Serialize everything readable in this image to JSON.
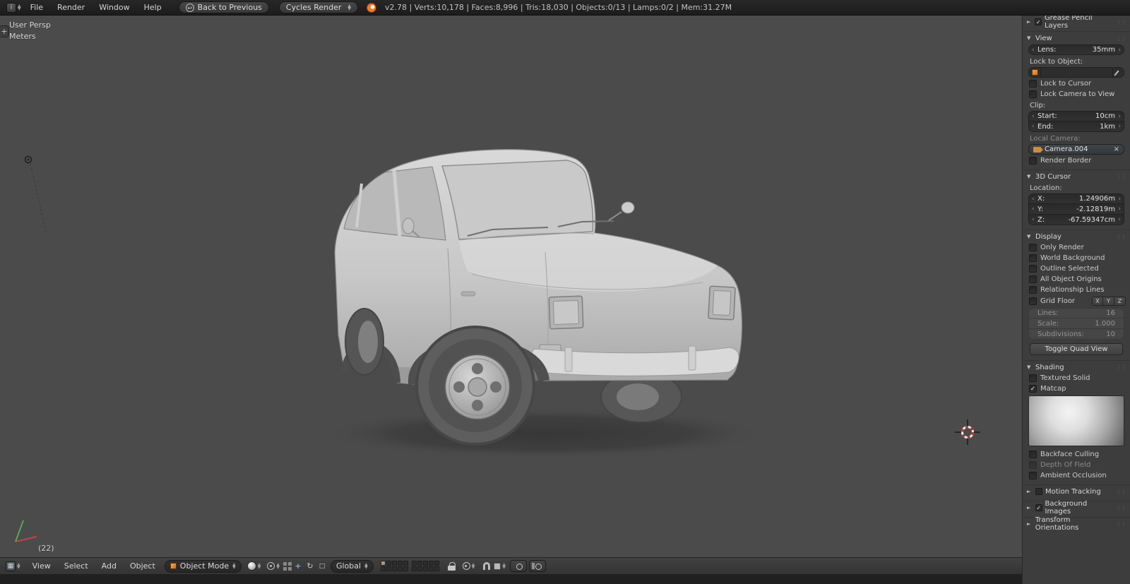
{
  "colors": {
    "accent_orange": "#e9822e",
    "viewport_bg": "#4b4b4b",
    "header_bg": "#1e1e1e",
    "panel_bg": "#3d3d3d"
  },
  "top_bar": {
    "menus": [
      "File",
      "Render",
      "Window",
      "Help"
    ],
    "back_button": "Back to Previous",
    "engine_dropdown": "Cycles Render",
    "stats": "v2.78 | Verts:10,178 | Faces:8,996 | Tris:18,030 | Objects:0/13 | Lamps:0/2 | Mem:31.27M"
  },
  "viewport": {
    "view_label": "User Persp",
    "units_label": "Meters",
    "object_info": "(22)"
  },
  "bottom_bar": {
    "menus": [
      "View",
      "Select",
      "Add",
      "Object"
    ],
    "mode_dropdown": "Object Mode",
    "orientation_dropdown": "Global"
  },
  "sidebar": {
    "grease_pencil": {
      "title": "Grease Pencil Layers"
    },
    "view": {
      "title": "View",
      "lens": {
        "label": "Lens:",
        "value": "35mm"
      },
      "lock_to_object_label": "Lock to Object:",
      "lock_to_cursor": "Lock to Cursor",
      "lock_camera_to_view": "Lock Camera to View",
      "clip_label": "Clip:",
      "clip_start": {
        "label": "Start:",
        "value": "10cm"
      },
      "clip_end": {
        "label": "End:",
        "value": "1km"
      },
      "local_camera_label": "Local Camera:",
      "camera_name": "Camera.004",
      "render_border": "Render Border"
    },
    "cursor_3d": {
      "title": "3D Cursor",
      "location_label": "Location:",
      "x": {
        "label": "X:",
        "value": "1.24906m"
      },
      "y": {
        "label": "Y:",
        "value": "-2.12819m"
      },
      "z": {
        "label": "Z:",
        "value": "-67.59347cm"
      }
    },
    "display": {
      "title": "Display",
      "checkboxes": [
        "Only Render",
        "World Background",
        "Outline Selected",
        "All Object Origins",
        "Relationship Lines",
        "Grid Floor"
      ],
      "axis_toggles": [
        "X",
        "Y",
        "Z"
      ],
      "lines": {
        "label": "Lines:",
        "value": "16"
      },
      "scale": {
        "label": "Scale:",
        "value": "1.000"
      },
      "subdivisions": {
        "label": "Subdivisions:",
        "value": "10"
      },
      "quad_view_button": "Toggle Quad View"
    },
    "shading": {
      "title": "Shading",
      "textured_solid": "Textured Solid",
      "matcap": "Matcap",
      "backface_culling": "Backface Culling",
      "depth_of_field": "Depth Of Field",
      "ambient_occlusion": "Ambient Occlusion"
    },
    "motion_tracking": {
      "title": "Motion Tracking"
    },
    "background_images": {
      "title": "Background Images"
    },
    "transform_orientations": {
      "title": "Transform Orientations"
    }
  }
}
